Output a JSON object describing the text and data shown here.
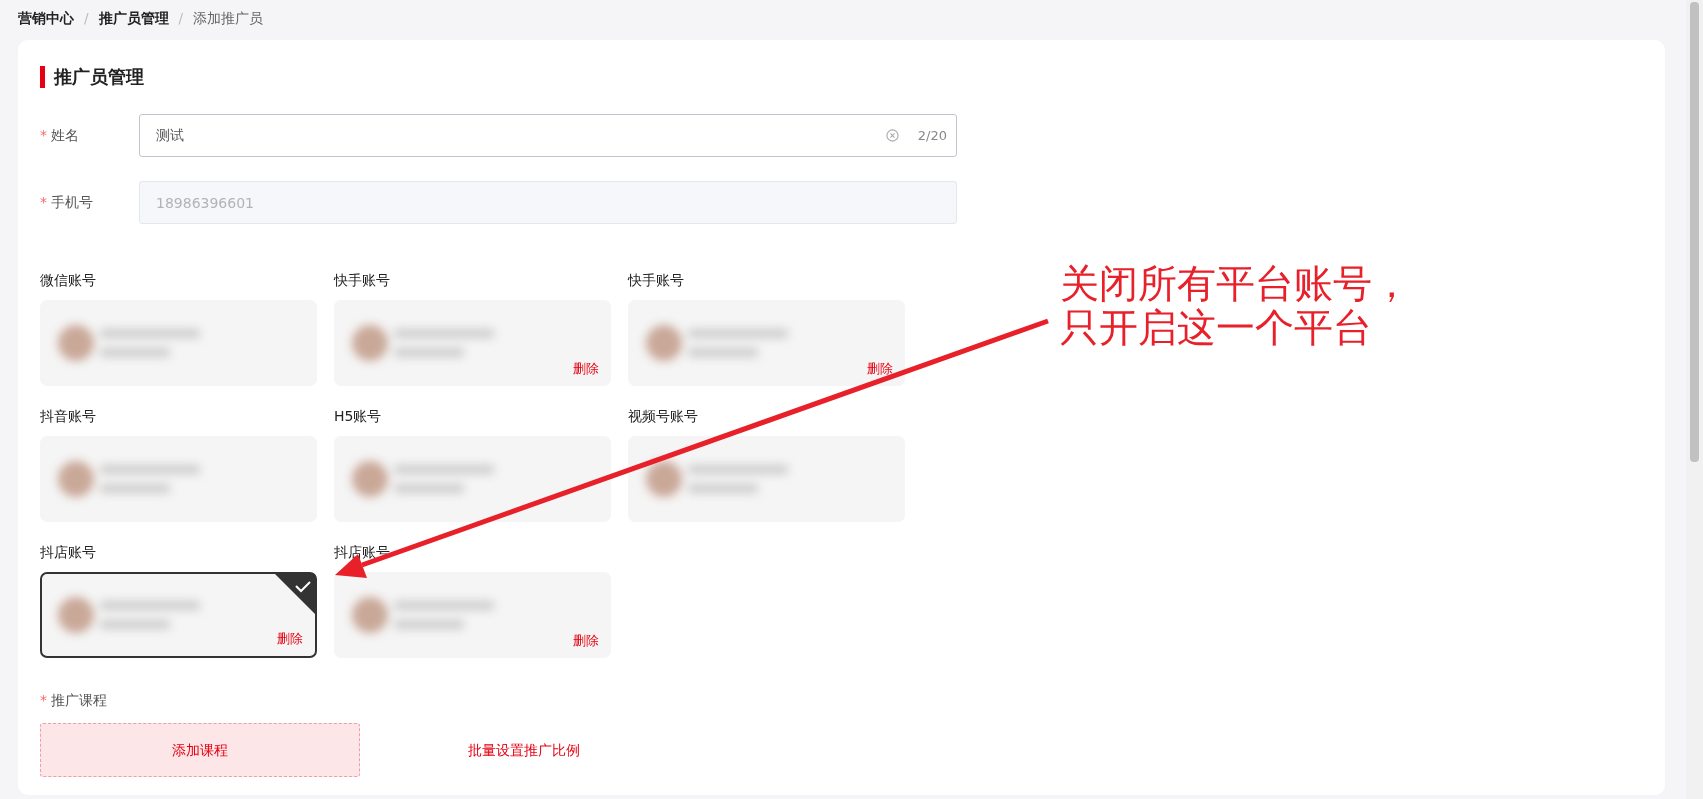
{
  "breadcrumb": [
    {
      "label": "营销中心",
      "current": false
    },
    {
      "label": "推广员管理",
      "current": false
    },
    {
      "label": "添加推广员",
      "current": true
    }
  ],
  "breadcrumb_separator": "/",
  "section_title": "推广员管理",
  "form": {
    "fields": [
      {
        "kind": "text",
        "required_mark": "*",
        "label": "姓名",
        "value": "测试",
        "count": "2/20",
        "disabled": false
      },
      {
        "kind": "text",
        "required_mark": "*",
        "label": "手机号",
        "placeholder": "18986396601",
        "disabled": true
      }
    ]
  },
  "accounts": [
    {
      "label": "微信账号",
      "selected": false
    },
    {
      "label": "快手账号",
      "selected": false,
      "delete_label": "删除"
    },
    {
      "label": "快手账号",
      "selected": false,
      "delete_label": "删除"
    },
    {
      "label": "抖音账号",
      "selected": false
    },
    {
      "label": "H5账号",
      "selected": false
    },
    {
      "label": "视频号账号",
      "selected": false
    },
    {
      "label": "抖店账号",
      "selected": true,
      "delete_label": "删除"
    },
    {
      "label": "抖店账号",
      "selected": false,
      "delete_label": "删除"
    }
  ],
  "courses": {
    "required_mark": "*",
    "label": "推广课程",
    "add_button": "添加课程",
    "batch_link": "批量设置推广比例"
  },
  "annotation": {
    "lines": [
      "关闭所有平台账号，",
      "只开启这一个平台"
    ]
  }
}
